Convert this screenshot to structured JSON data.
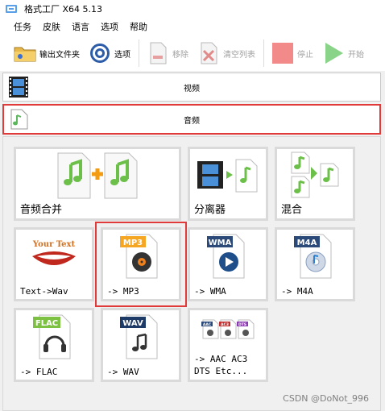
{
  "window": {
    "title": "格式工厂 X64 5.13"
  },
  "menu": [
    "任务",
    "皮肤",
    "语言",
    "选项",
    "帮助"
  ],
  "toolbar": {
    "output_folder": "输出文件夹",
    "options": "选项",
    "remove": "移除",
    "clear_list": "清空列表",
    "stop": "停止",
    "start": "开始"
  },
  "categories": {
    "video": "视频",
    "audio": "音频"
  },
  "tiles": {
    "merge": "音频合并",
    "splitter": "分离器",
    "mix": "混合",
    "text_to_wav": "Text->Wav",
    "to_mp3": "-> MP3",
    "to_wma": "-> WMA",
    "to_m4a": "-> M4A",
    "to_flac": "-> FLAC",
    "to_wav": "-> WAV",
    "to_others": "-> AAC AC3\nDTS Etc..."
  },
  "badges": {
    "mp3": "MP3",
    "wma": "WMA",
    "m4a": "M4A",
    "flac": "FLAC",
    "wav": "WAV",
    "your_text": "Your Text",
    "aac": "AAC",
    "ac3": "AC3",
    "dts": "DTS"
  },
  "watermark": "CSDN @DoNot_996",
  "colors": {
    "accent_red": "#e03a3a",
    "note_green": "#7ac142",
    "badge_orange": "#f5a623",
    "badge_navy": "#2b4a7a",
    "badge_green": "#7cc142"
  }
}
